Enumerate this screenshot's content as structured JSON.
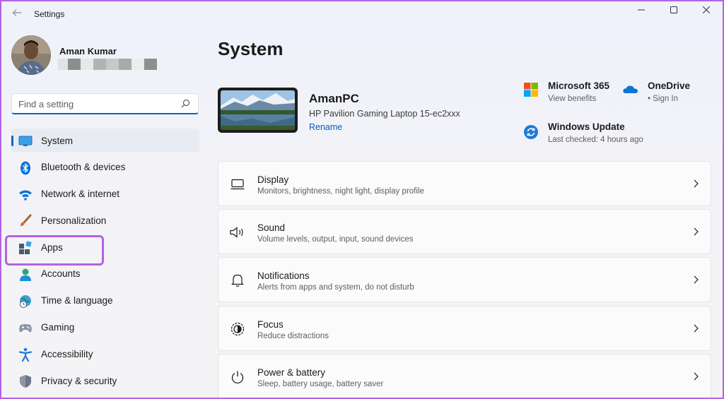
{
  "window": {
    "title": "Settings",
    "accent": "#0067c0",
    "highlight": "#b163e6"
  },
  "profile": {
    "name": "Aman Kumar"
  },
  "search": {
    "placeholder": "Find a setting"
  },
  "sidebar": {
    "items": [
      {
        "label": "System",
        "icon": "system-display-icon",
        "selected": true
      },
      {
        "label": "Bluetooth & devices",
        "icon": "bluetooth-icon"
      },
      {
        "label": "Network & internet",
        "icon": "wifi-icon"
      },
      {
        "label": "Personalization",
        "icon": "paintbrush-icon"
      },
      {
        "label": "Apps",
        "icon": "apps-icon",
        "highlighted": true
      },
      {
        "label": "Accounts",
        "icon": "accounts-icon"
      },
      {
        "label": "Time & language",
        "icon": "globe-clock-icon"
      },
      {
        "label": "Gaming",
        "icon": "gamepad-icon"
      },
      {
        "label": "Accessibility",
        "icon": "accessibility-icon"
      },
      {
        "label": "Privacy & security",
        "icon": "shield-icon"
      }
    ]
  },
  "main": {
    "title": "System",
    "device": {
      "name": "AmanPC",
      "model": "HP Pavilion Gaming Laptop 15-ec2xxx",
      "rename": "Rename"
    },
    "quick_links": {
      "microsoft365": {
        "title": "Microsoft 365",
        "sub": "View benefits"
      },
      "onedrive": {
        "title": "OneDrive",
        "sub": "• Sign In"
      },
      "windows_update": {
        "title": "Windows Update",
        "sub": "Last checked: 4 hours ago"
      }
    },
    "cards": [
      {
        "title": "Display",
        "sub": "Monitors, brightness, night light, display profile",
        "icon": "monitor-icon"
      },
      {
        "title": "Sound",
        "sub": "Volume levels, output, input, sound devices",
        "icon": "speaker-icon"
      },
      {
        "title": "Notifications",
        "sub": "Alerts from apps and system, do not disturb",
        "icon": "bell-icon"
      },
      {
        "title": "Focus",
        "sub": "Reduce distractions",
        "icon": "focus-icon"
      },
      {
        "title": "Power & battery",
        "sub": "Sleep, battery usage, battery saver",
        "icon": "power-icon"
      }
    ]
  }
}
